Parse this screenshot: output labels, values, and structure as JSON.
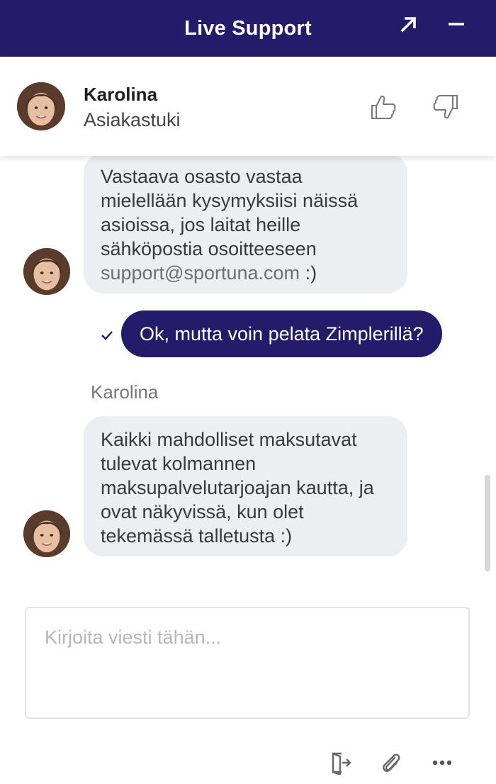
{
  "header": {
    "title": "Live Support",
    "popout_icon": "arrow-up-right-icon",
    "minimize_icon": "minus-icon",
    "background": "#241b6b"
  },
  "agent": {
    "name": "Karolina",
    "role": "Asiakastuki",
    "rating_icons": [
      "thumbs-up-icon",
      "thumbs-down-icon"
    ]
  },
  "messages": [
    {
      "from": "agent",
      "text": "Vastaava osasto vastaa mielellään kysymyksiisi näissä asioissa, jos laitat heille sähköpostia osoitteeseen ",
      "link": "support@sportuna.com",
      "suffix": " :)"
    },
    {
      "from": "user",
      "text": "Ok, mutta voin pelata Zimplerillä?",
      "status_icon": "check-icon"
    },
    {
      "from": "agent",
      "sender": "Karolina",
      "text": "Kaikki mahdolliset maksutavat tulevat kolmannen maksupalvelutarjoajan kautta, ja ovat näkyvissä, kun olet tekemässä talletusta :)"
    }
  ],
  "composer": {
    "placeholder": "Kirjoita viesti tähän...",
    "value": ""
  },
  "footer": {
    "icons": [
      "exit-icon",
      "paperclip-icon",
      "more-icon"
    ]
  },
  "colors": {
    "brand": "#241b6b",
    "agent_bubble": "#eceef1",
    "user_bubble": "#241b6b"
  }
}
